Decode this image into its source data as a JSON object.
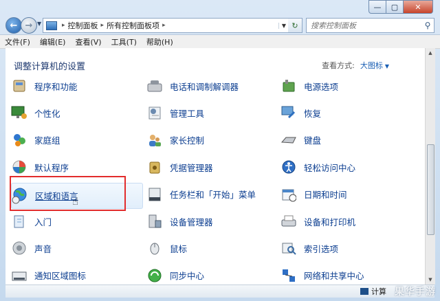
{
  "window": {
    "min_glyph": "—",
    "max_glyph": "▢",
    "close_glyph": "✕"
  },
  "address": {
    "crumbs": [
      "控制面板",
      "所有控制面板项"
    ],
    "separator": "▸"
  },
  "search": {
    "placeholder": "搜索控制面板"
  },
  "menu": [
    "文件(F)",
    "编辑(E)",
    "查看(V)",
    "工具(T)",
    "帮助(H)"
  ],
  "page": {
    "heading": "调整计算机的设置",
    "view_by_label": "查看方式:",
    "view_by_value": "大图标"
  },
  "items": [
    {
      "label": "程序和功能",
      "icon": "programs-icon"
    },
    {
      "label": "电话和调制解调器",
      "icon": "phone-modem-icon"
    },
    {
      "label": "电源选项",
      "icon": "power-icon"
    },
    {
      "label": "个性化",
      "icon": "personalization-icon"
    },
    {
      "label": "管理工具",
      "icon": "admin-tools-icon"
    },
    {
      "label": "恢复",
      "icon": "recovery-icon"
    },
    {
      "label": "家庭组",
      "icon": "homegroup-icon"
    },
    {
      "label": "家长控制",
      "icon": "parental-controls-icon"
    },
    {
      "label": "键盘",
      "icon": "keyboard-icon"
    },
    {
      "label": "默认程序",
      "icon": "default-programs-icon"
    },
    {
      "label": "凭据管理器",
      "icon": "credential-manager-icon"
    },
    {
      "label": "轻松访问中心",
      "icon": "ease-of-access-icon"
    },
    {
      "label": "区域和语言",
      "icon": "region-language-icon"
    },
    {
      "label": "任务栏和「开始」菜单",
      "icon": "taskbar-icon"
    },
    {
      "label": "日期和时间",
      "icon": "date-time-icon"
    },
    {
      "label": "入门",
      "icon": "getting-started-icon"
    },
    {
      "label": "设备管理器",
      "icon": "device-manager-icon"
    },
    {
      "label": "设备和打印机",
      "icon": "devices-printers-icon"
    },
    {
      "label": "声音",
      "icon": "sound-icon"
    },
    {
      "label": "鼠标",
      "icon": "mouse-icon"
    },
    {
      "label": "索引选项",
      "icon": "indexing-icon"
    },
    {
      "label": "通知区域图标",
      "icon": "notification-area-icon"
    },
    {
      "label": "同步中心",
      "icon": "sync-center-icon"
    },
    {
      "label": "网络和共享中心",
      "icon": "network-sharing-icon"
    }
  ],
  "status": {
    "text": "计算"
  },
  "watermark": "果华手游"
}
